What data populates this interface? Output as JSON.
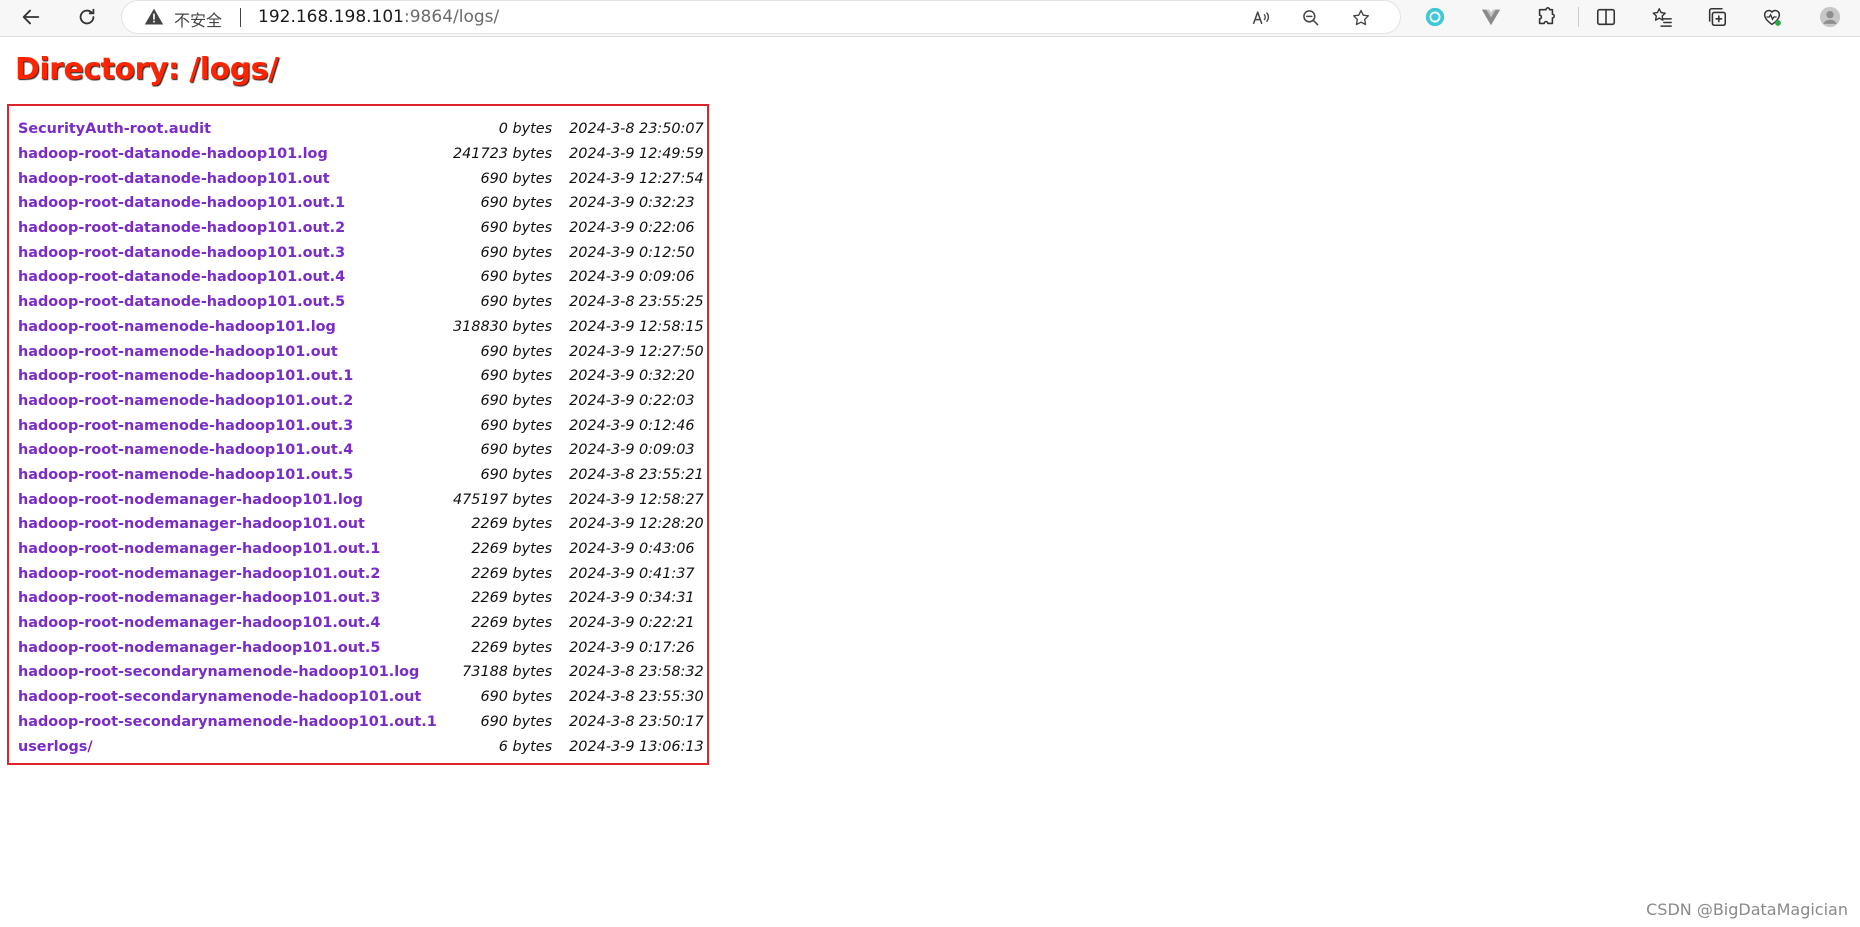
{
  "browser": {
    "security_label": "不安全",
    "url_host": "192.168.198.101",
    "url_rest": ":9864/logs/",
    "profile_avatar": "profile-avatar"
  },
  "page": {
    "title": "Directory: /logs/",
    "entries": [
      {
        "name": "SecurityAuth-root.audit",
        "size": "0 bytes",
        "date": "2024-3-8 23:50:07"
      },
      {
        "name": "hadoop-root-datanode-hadoop101.log",
        "size": "241723 bytes",
        "date": "2024-3-9 12:49:59"
      },
      {
        "name": "hadoop-root-datanode-hadoop101.out",
        "size": "690 bytes",
        "date": "2024-3-9 12:27:54"
      },
      {
        "name": "hadoop-root-datanode-hadoop101.out.1",
        "size": "690 bytes",
        "date": "2024-3-9 0:32:23"
      },
      {
        "name": "hadoop-root-datanode-hadoop101.out.2",
        "size": "690 bytes",
        "date": "2024-3-9 0:22:06"
      },
      {
        "name": "hadoop-root-datanode-hadoop101.out.3",
        "size": "690 bytes",
        "date": "2024-3-9 0:12:50"
      },
      {
        "name": "hadoop-root-datanode-hadoop101.out.4",
        "size": "690 bytes",
        "date": "2024-3-9 0:09:06"
      },
      {
        "name": "hadoop-root-datanode-hadoop101.out.5",
        "size": "690 bytes",
        "date": "2024-3-8 23:55:25"
      },
      {
        "name": "hadoop-root-namenode-hadoop101.log",
        "size": "318830 bytes",
        "date": "2024-3-9 12:58:15"
      },
      {
        "name": "hadoop-root-namenode-hadoop101.out",
        "size": "690 bytes",
        "date": "2024-3-9 12:27:50"
      },
      {
        "name": "hadoop-root-namenode-hadoop101.out.1",
        "size": "690 bytes",
        "date": "2024-3-9 0:32:20"
      },
      {
        "name": "hadoop-root-namenode-hadoop101.out.2",
        "size": "690 bytes",
        "date": "2024-3-9 0:22:03"
      },
      {
        "name": "hadoop-root-namenode-hadoop101.out.3",
        "size": "690 bytes",
        "date": "2024-3-9 0:12:46"
      },
      {
        "name": "hadoop-root-namenode-hadoop101.out.4",
        "size": "690 bytes",
        "date": "2024-3-9 0:09:03"
      },
      {
        "name": "hadoop-root-namenode-hadoop101.out.5",
        "size": "690 bytes",
        "date": "2024-3-8 23:55:21"
      },
      {
        "name": "hadoop-root-nodemanager-hadoop101.log",
        "size": "475197 bytes",
        "date": "2024-3-9 12:58:27"
      },
      {
        "name": "hadoop-root-nodemanager-hadoop101.out",
        "size": "2269 bytes",
        "date": "2024-3-9 12:28:20"
      },
      {
        "name": "hadoop-root-nodemanager-hadoop101.out.1",
        "size": "2269 bytes",
        "date": "2024-3-9 0:43:06"
      },
      {
        "name": "hadoop-root-nodemanager-hadoop101.out.2",
        "size": "2269 bytes",
        "date": "2024-3-9 0:41:37"
      },
      {
        "name": "hadoop-root-nodemanager-hadoop101.out.3",
        "size": "2269 bytes",
        "date": "2024-3-9 0:34:31"
      },
      {
        "name": "hadoop-root-nodemanager-hadoop101.out.4",
        "size": "2269 bytes",
        "date": "2024-3-9 0:22:21"
      },
      {
        "name": "hadoop-root-nodemanager-hadoop101.out.5",
        "size": "2269 bytes",
        "date": "2024-3-9 0:17:26"
      },
      {
        "name": "hadoop-root-secondarynamenode-hadoop101.log",
        "size": "73188 bytes",
        "date": "2024-3-8 23:58:32"
      },
      {
        "name": "hadoop-root-secondarynamenode-hadoop101.out",
        "size": "690 bytes",
        "date": "2024-3-8 23:55:30"
      },
      {
        "name": "hadoop-root-secondarynamenode-hadoop101.out.1",
        "size": "690 bytes",
        "date": "2024-3-8 23:50:17"
      },
      {
        "name": "userlogs/",
        "size": "6 bytes",
        "date": "2024-3-9 13:06:13"
      }
    ]
  },
  "watermark": "CSDN @BigDataMagician",
  "colors": {
    "title": "#ff2400",
    "link": "#7b2bc7",
    "highlight_box": "#e0222a"
  }
}
